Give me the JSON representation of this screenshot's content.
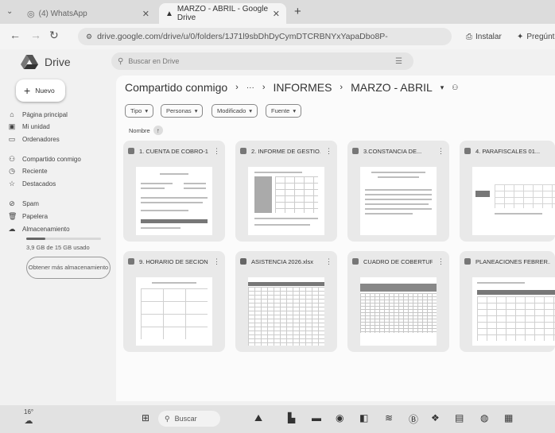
{
  "browser": {
    "tabs": [
      {
        "label": "(4) WhatsApp",
        "active": false
      },
      {
        "label": "MARZO - ABRIL - Google Drive",
        "active": true
      }
    ],
    "new_tab": "+",
    "url": "drive.google.com/drive/u/0/folders/1J71l9sbDhDyCymDTCRBNYxYapaDbo8P-",
    "install_label": "Instalar",
    "ask_label": "Pregúnt"
  },
  "drive": {
    "logo_text": "Drive",
    "search_placeholder": "Buscar en Drive",
    "new_button": "Nuevo",
    "nav": [
      {
        "label": "Página principal",
        "icon": "home-icon"
      },
      {
        "label": "Mi unidad",
        "icon": "my-drive-icon"
      },
      {
        "label": "Ordenadores",
        "icon": "computer-icon"
      },
      {
        "label": "Compartido conmigo",
        "icon": "shared-icon"
      },
      {
        "label": "Reciente",
        "icon": "clock-icon"
      },
      {
        "label": "Destacados",
        "icon": "star-icon"
      },
      {
        "label": "Spam",
        "icon": "spam-icon"
      },
      {
        "label": "Papelera",
        "icon": "trash-icon"
      },
      {
        "label": "Almacenamiento",
        "icon": "cloud-icon"
      }
    ],
    "storage_text": "3,9 GB de 15 GB usado",
    "storage_fraction": 0.26,
    "get_more": "Obtener más almacenamiento",
    "breadcrumb": {
      "root": "Compartido conmigo",
      "ellipsis": "···",
      "parent": "INFORMES",
      "current": "MARZO - ABRIL"
    },
    "filters": [
      "Tipo",
      "Personas",
      "Modificado",
      "Fuente"
    ],
    "sort_label": "Nombre",
    "files": [
      {
        "title": "1. CUENTA DE COBRO-1-...",
        "type": "pdf"
      },
      {
        "title": "2. INFORME DE GESTIO...",
        "type": "pdf"
      },
      {
        "title": "3.CONSTANCIA DE...",
        "type": "pdf"
      },
      {
        "title": "4. PARAFISCALES 01...",
        "type": "image"
      },
      {
        "title": "9. HORARIO DE SECION...",
        "type": "pdf"
      },
      {
        "title": "ASISTENCIA 2026.xlsx",
        "type": "sheet"
      },
      {
        "title": "CUADRO DE COBERTUR...",
        "type": "pdf"
      },
      {
        "title": "PLANEACIONES FEBRER...",
        "type": "pdf"
      }
    ]
  },
  "taskbar": {
    "weather": "16°",
    "search_label": "Buscar"
  }
}
